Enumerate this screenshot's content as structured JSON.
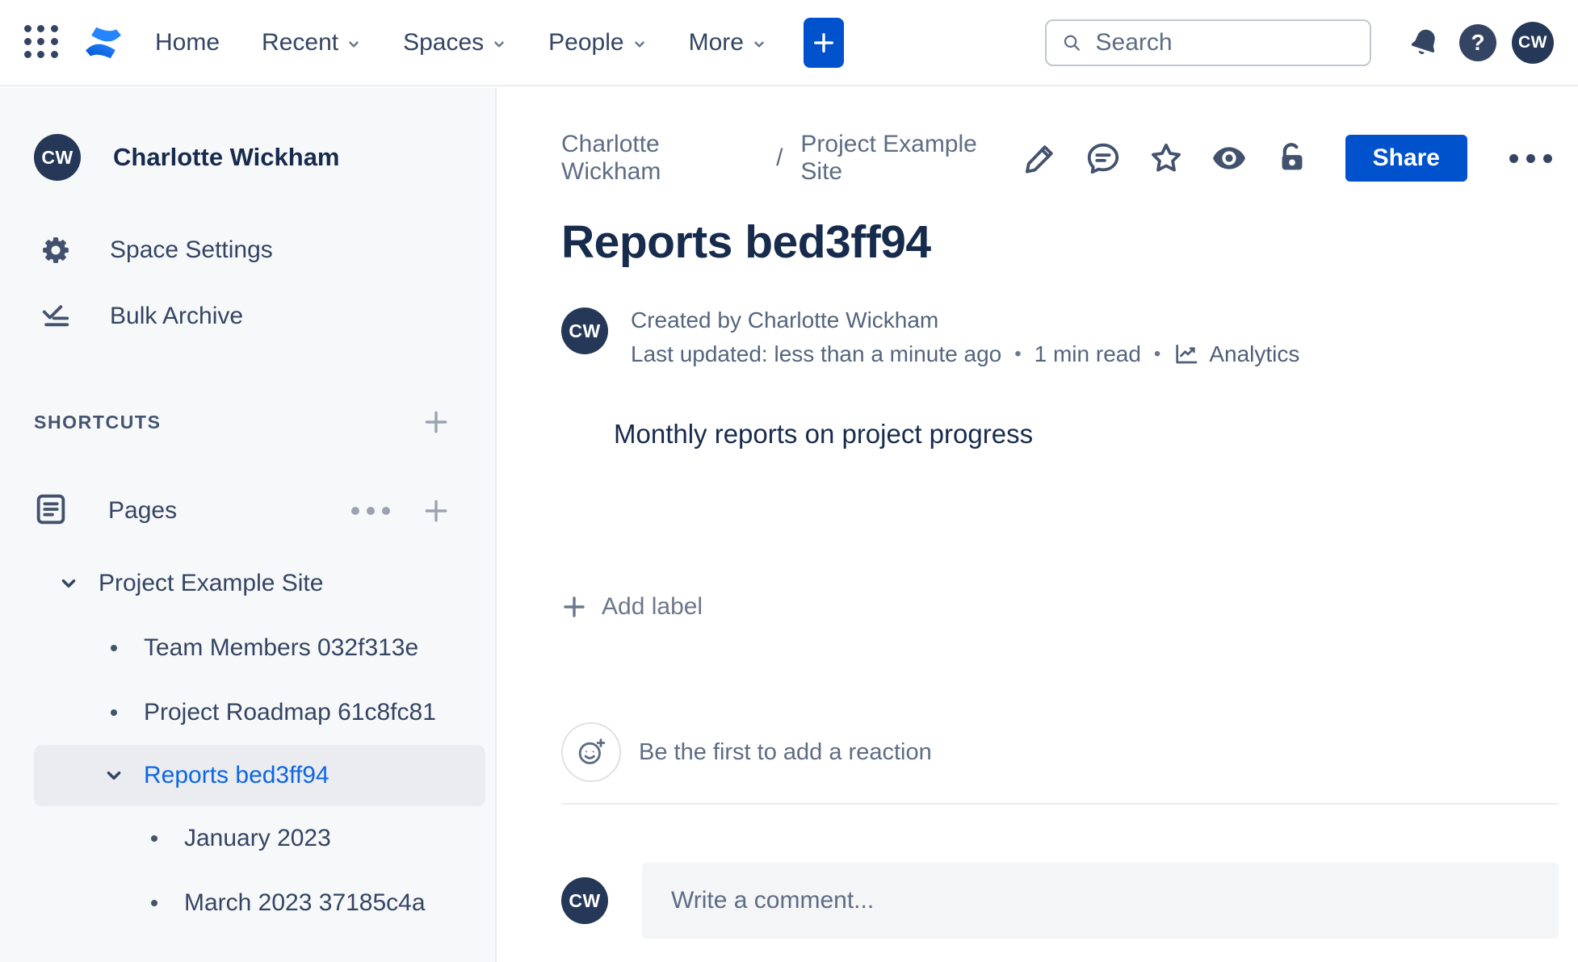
{
  "topbar": {
    "nav": [
      "Home",
      "Recent",
      "Spaces",
      "People",
      "More"
    ],
    "search_placeholder": "Search",
    "help_glyph": "?",
    "avatar_initials": "CW"
  },
  "sidebar": {
    "profile_name": "Charlotte Wickham",
    "profile_initials": "CW",
    "space_settings_label": "Space Settings",
    "bulk_archive_label": "Bulk Archive",
    "shortcuts_heading": "SHORTCUTS",
    "pages_label": "Pages",
    "tree": [
      {
        "label": "Project Example Site"
      },
      {
        "label": "Team Members 032f313e"
      },
      {
        "label": "Project Roadmap 61c8fc81"
      },
      {
        "label": "Reports bed3ff94"
      },
      {
        "label": "January 2023"
      },
      {
        "label": "March 2023 37185c4a"
      }
    ]
  },
  "content": {
    "breadcrumb": {
      "space": "Charlotte Wickham",
      "separator": "/",
      "page": "Project Example Site"
    },
    "share_label": "Share",
    "title": "Reports bed3ff94",
    "byline": {
      "initials": "CW",
      "created": "Created by Charlotte Wickham",
      "updated": "Last updated: less than a minute ago",
      "dot": "•",
      "read_time": "1 min read",
      "analytics_label": "Analytics"
    },
    "body_text": "Monthly reports on project progress",
    "add_label_text": "Add label",
    "reaction_prompt": "Be the first to add a reaction",
    "comment": {
      "initials": "CW",
      "placeholder": "Write a comment..."
    }
  },
  "colors": {
    "brand_blue": "#0052CC",
    "selected_link_blue": "#0C66E4",
    "navy_text": "#172B4D",
    "sidebar_bg": "#F7F8FA",
    "selected_row_bg": "#EAECF0"
  }
}
